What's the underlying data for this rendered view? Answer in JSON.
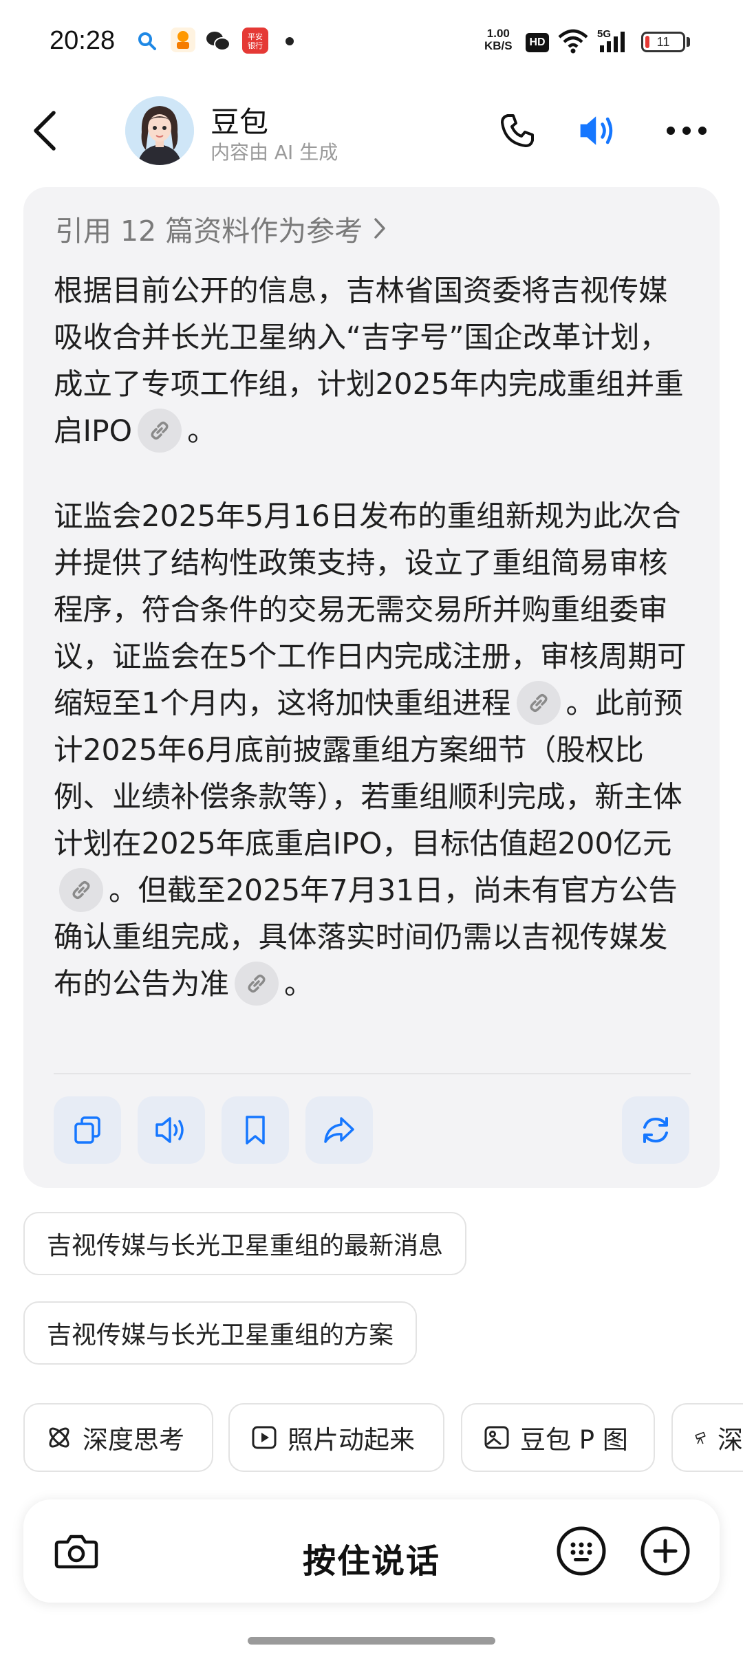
{
  "status_bar": {
    "time": "20:28",
    "net_speed_value": "1.00",
    "net_speed_unit": "KB/S",
    "hd": "HD",
    "network": "5G",
    "battery": "11",
    "app_icons": [
      "search-icon",
      "app-icon",
      "wechat-icon",
      "bank-app-icon"
    ],
    "bank_app_label": "平安银行"
  },
  "header": {
    "bot_name": "豆包",
    "subtitle": "内容由 AI 生成"
  },
  "message": {
    "references": "引用 12 篇资料作为参考",
    "p1_a": "根据目前公开的信息，吉林省国资委将吉视传媒吸收合并长光卫星纳入“吉字号”国企改革计划，成立了专项工作组，计划2025年内完成重组并重启IPO",
    "p1_b": "。",
    "p2_a": "证监会2025年5月16日发布的重组新规为此次合并提供了结构性政策支持，设立了重组简易审核程序，符合条件的交易无需交易所并购重组委审议，证监会在5个工作日内完成注册，审核周期可缩短至1个月内，这将加快重组进程",
    "p2_b": "。此前预计2025年6月底前披露重组方案细节（股权比例、业绩补偿条款等），若重组顺利完成，新主体计划在2025年底重启IPO，目标估值超200亿元",
    "p2_c": "。但截至2025年7月31日，尚未有官方公告确认重组完成，具体落实时间仍需以吉视传媒发布的公告为准",
    "p2_d": "。"
  },
  "suggestions": [
    "吉视传媒与长光卫星重组的最新消息",
    "吉视传媒与长光卫星重组的方案"
  ],
  "tools": [
    "深度思考",
    "照片动起来",
    "豆包 P 图",
    "深"
  ],
  "input_bar": {
    "hold_to_talk": "按住说话"
  },
  "colors": {
    "accent": "#1677ff",
    "card_bg": "#f3f3f5",
    "action_bg": "#e7ecf5"
  }
}
